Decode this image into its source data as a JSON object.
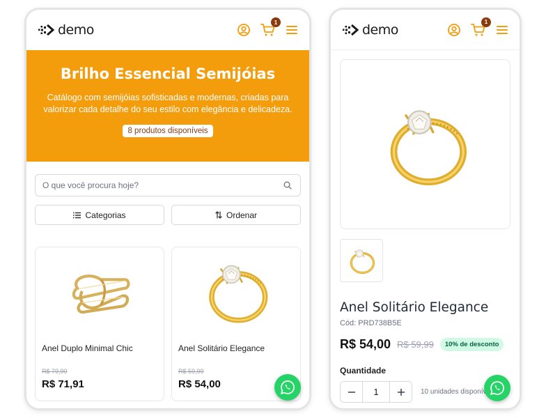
{
  "colors": {
    "accent": "#f39c0c",
    "badge": "#8b3a0e",
    "whatsapp": "#25d366",
    "discount_bg": "#d1fae5"
  },
  "brand": {
    "logo_text": "demo"
  },
  "header": {
    "cart_count": "1",
    "icons": [
      "user-circle-icon",
      "cart-icon",
      "menu-icon"
    ]
  },
  "catalog": {
    "title": "Brilho Essencial Semijóias",
    "description": "Catálogo com semijóias sofisticadas e modernas, criadas para valorizar cada detalhe do seu estilo com elegância e delicadeza.",
    "badge": "8 produtos disponíveis",
    "search_placeholder": "O que você procura hoje?",
    "categories_label": "Categorias",
    "sort_label": "Ordenar",
    "products": [
      {
        "name": "Anel Duplo Minimal Chic",
        "old_price": "R$ 79,90",
        "price": "R$ 71,91"
      },
      {
        "name": "Anel Solitário Elegance",
        "old_price": "R$ 59,99",
        "price": "R$ 54,00"
      }
    ]
  },
  "product": {
    "name": "Anel Solitário Elegance",
    "code": "Cód: PRD738B5E",
    "price": "R$ 54,00",
    "old_price": "R$ 59,99",
    "discount": "10% de desconto",
    "quantity_label": "Quantidade",
    "quantity": "1",
    "stock": "10 unidades disponíveis"
  }
}
